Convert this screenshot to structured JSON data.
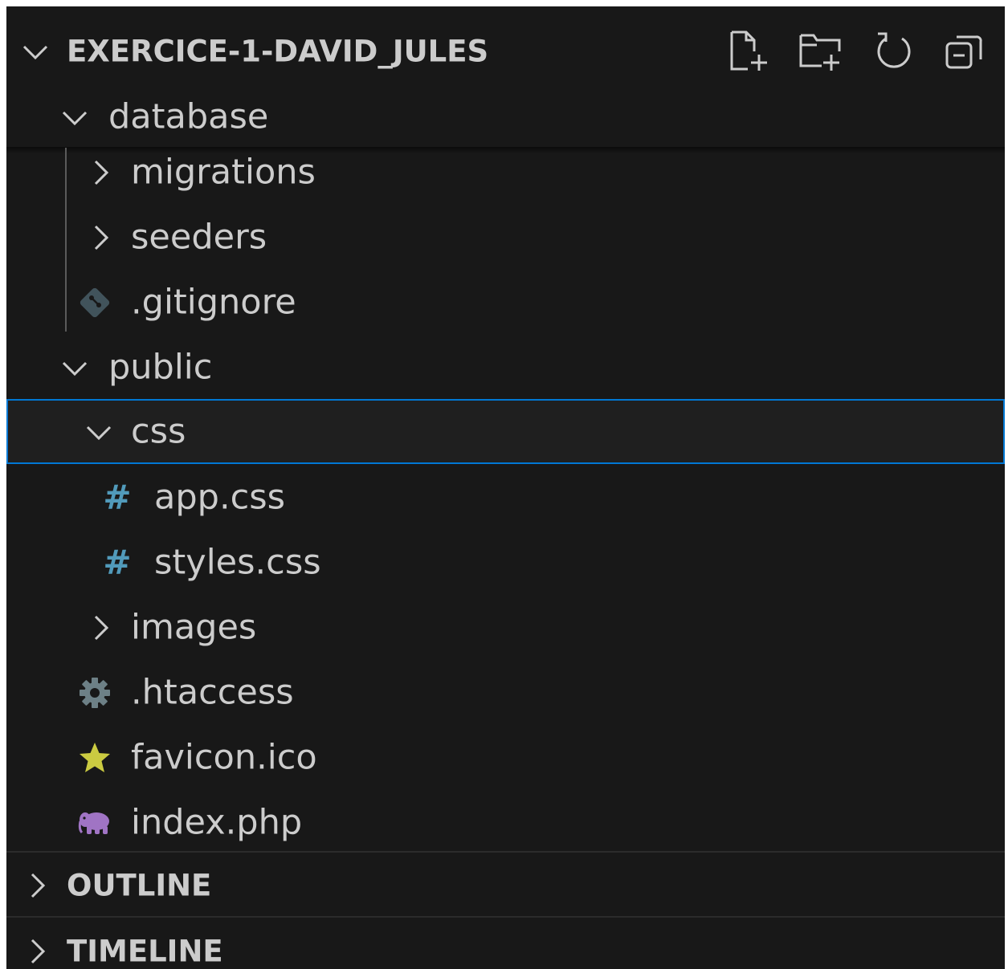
{
  "explorer": {
    "title": "EXERCICE-1-DAVID_JULES",
    "actions": {
      "new_file": "new-file-icon",
      "new_folder": "new-folder-icon",
      "refresh": "refresh-icon",
      "collapse": "collapse-all-icon"
    },
    "tree": {
      "database": "database",
      "migrations": "migrations",
      "seeders": "seeders",
      "gitignore": ".gitignore",
      "public": "public",
      "css": "css",
      "app_css": "app.css",
      "styles_css": "styles.css",
      "images": "images",
      "htaccess": ".htaccess",
      "favicon": "favicon.ico",
      "index_php": "index.php"
    },
    "css_icon_glyph": "#"
  },
  "outline": {
    "title": "OUTLINE"
  },
  "timeline": {
    "title": "TIMELINE"
  },
  "colors": {
    "background": "#181818",
    "text": "#cccccc",
    "selection_border": "#0078d4",
    "css_icon": "#519aba",
    "git_icon": "#41535b",
    "gear_icon": "#6d8086",
    "star_icon": "#cbcb41",
    "php_icon": "#a074c4"
  }
}
